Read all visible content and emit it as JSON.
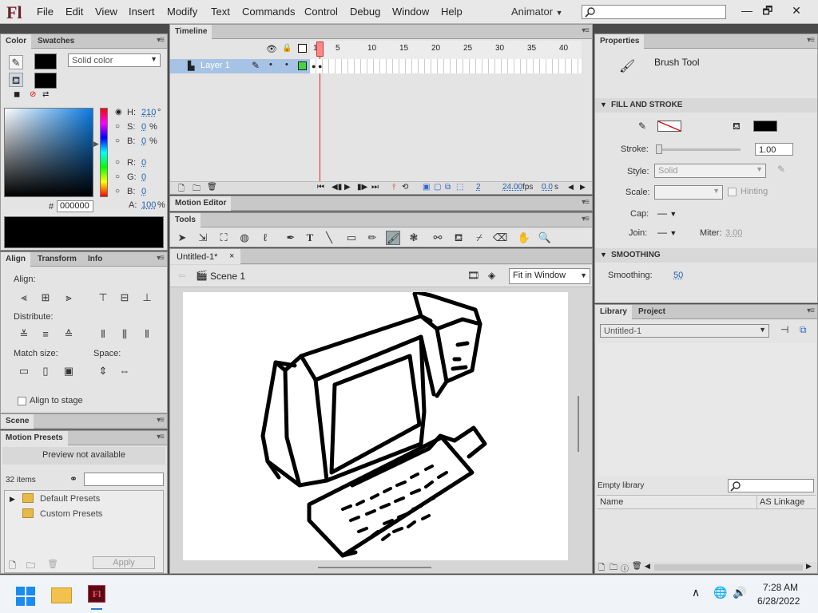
{
  "app": {
    "logo": "Fl",
    "menus": [
      "File",
      "Edit",
      "View",
      "Insert",
      "Modify",
      "Text",
      "Commands",
      "Control",
      "Debug",
      "Window",
      "Help"
    ],
    "workspace": "Animator",
    "search_placeholder": ""
  },
  "window": {
    "minimize": "—",
    "restore": "🗗",
    "close": "✕"
  },
  "color_panel": {
    "tabs": [
      "Color",
      "Swatches"
    ],
    "type": "Solid color",
    "hsb": {
      "h": "210",
      "h_unit": "°",
      "s": "0",
      "s_unit": "%",
      "b": "0",
      "b_unit": "%"
    },
    "rgb": {
      "r": "0",
      "g": "0",
      "b": "0"
    },
    "alpha": "100",
    "alpha_unit": "%",
    "hex": "000000",
    "labels": {
      "h": "H:",
      "s": "S:",
      "b": "B:",
      "r": "R:",
      "g": "G:",
      "bl": "B:",
      "a": "A:",
      "hash": "#"
    }
  },
  "align_panel": {
    "tabs": [
      "Align",
      "Transform",
      "Info"
    ],
    "align_label": "Align:",
    "distribute_label": "Distribute:",
    "match_label": "Match size:",
    "space_label": "Space:",
    "stage_label": "Align to stage"
  },
  "scene_panel": {
    "tab": "Scene"
  },
  "presets_panel": {
    "tab": "Motion Presets",
    "preview": "Preview not available",
    "count": "32 items",
    "folders": [
      "Default Presets",
      "Custom Presets"
    ],
    "apply": "Apply"
  },
  "timeline": {
    "tab": "Timeline",
    "layer": "Layer 1",
    "frames": [
      "1",
      "5",
      "10",
      "15",
      "20",
      "25",
      "30",
      "35",
      "40"
    ],
    "current_frame": "2",
    "fps": "24.00",
    "fps_unit": "fps",
    "time": "0.0",
    "time_unit": "s"
  },
  "motion_editor": {
    "tab": "Motion Editor"
  },
  "tools": {
    "title": "Tools"
  },
  "document": {
    "tab": "Untitled-1*",
    "close": "×",
    "scene": "Scene 1",
    "zoom": "Fit in Window"
  },
  "properties": {
    "tab": "Properties",
    "tool": "Brush Tool",
    "section_fill": "FILL AND STROKE",
    "stroke_label": "Stroke:",
    "stroke_value": "1.00",
    "style_label": "Style:",
    "style_value": "Solid",
    "scale_label": "Scale:",
    "hinting": "Hinting",
    "cap_label": "Cap:",
    "join_label": "Join:",
    "miter_label": "Miter:",
    "miter_value": "3.00",
    "section_smooth": "SMOOTHING",
    "smoothing_label": "Smoothing:",
    "smoothing_value": "50"
  },
  "library": {
    "tabs": [
      "Library",
      "Project"
    ],
    "doc": "Untitled-1",
    "empty": "Empty library",
    "col_name": "Name",
    "col_linkage": "AS Linkage"
  },
  "taskbar": {
    "time": "7:28 AM",
    "date": "6/28/2022"
  }
}
